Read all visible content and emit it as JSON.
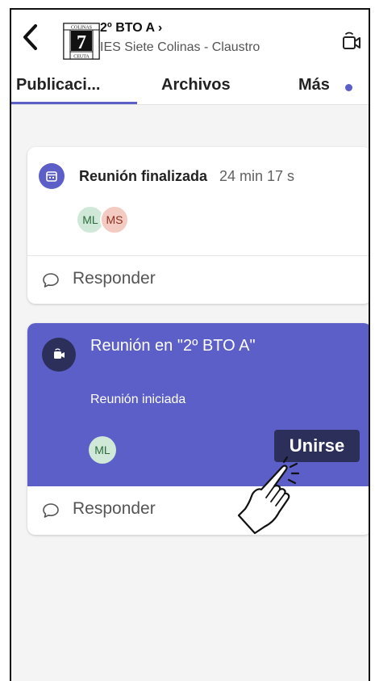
{
  "header": {
    "team_name": "2º BTO A ›",
    "org_name": "IES Siete Colinas - Claustro",
    "logo_text": "COLINAS SIETE 7 CEUTA"
  },
  "tabs": [
    {
      "label": "Publicaci..."
    },
    {
      "label": "Archivos"
    },
    {
      "label": "Más"
    }
  ],
  "posts": [
    {
      "title": "Reunión finalizada",
      "duration": "24 min 17 s",
      "avatars": [
        "ML",
        "MS"
      ],
      "reply_label": "Responder"
    },
    {
      "title": "Reunión en \"2º BTO A\"",
      "subtitle": "Reunión iniciada",
      "avatars": [
        "ML"
      ],
      "join_label": "Unirse",
      "reply_label": "Responder"
    }
  ],
  "colors": {
    "accent": "#5b5fc7",
    "dark_accent": "#2c2f5a"
  },
  "icons": [
    "back-chevron-icon",
    "team-logo",
    "meeting-video-icon",
    "calendar-icon",
    "live-meeting-icon",
    "reply-icon",
    "tap-hand-icon"
  ]
}
